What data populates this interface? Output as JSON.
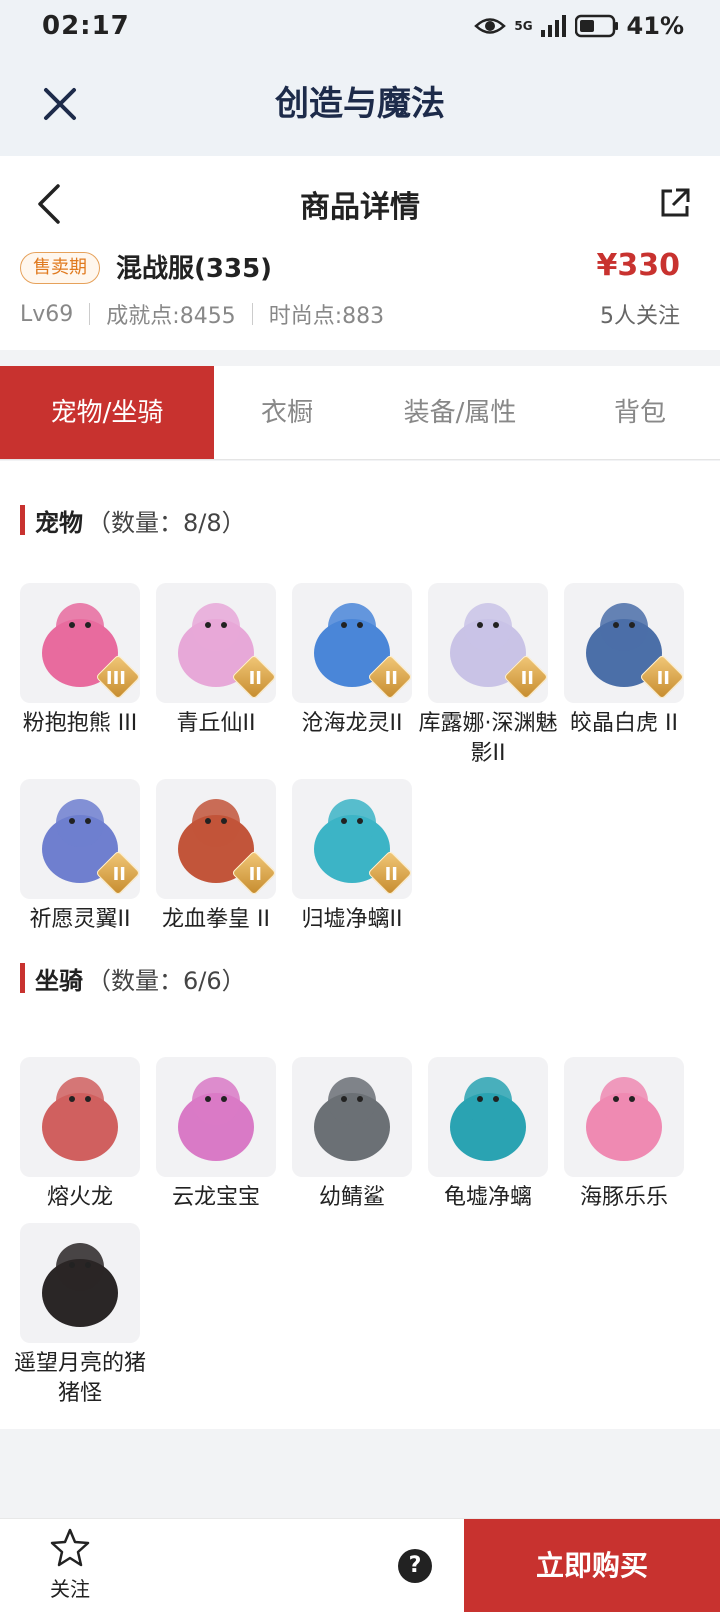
{
  "status": {
    "time": "02:17",
    "network": "5G",
    "battery": "41%"
  },
  "app": {
    "title": "创造与魔法"
  },
  "detail": {
    "nav_title": "商品详情",
    "badge": "售卖期",
    "server_name": "混战服(335)",
    "price": "¥330",
    "stats": {
      "level": "Lv69",
      "achievement": "成就点:8455",
      "fashion": "时尚点:883"
    },
    "followers": "5人关注"
  },
  "tabs": [
    "宠物/坐骑",
    "衣橱",
    "装备/属性",
    "背包"
  ],
  "pets": {
    "title": "宠物",
    "count": "（数量：8/8）",
    "items": [
      {
        "name": "粉抱抱熊 III",
        "tier": "III",
        "color": "#e86b9e"
      },
      {
        "name": "青丘仙II",
        "tier": "II",
        "color": "#e7a8d8"
      },
      {
        "name": "沧海龙灵II",
        "tier": "II",
        "color": "#4a86d8"
      },
      {
        "name": "库露娜·深渊魅影II",
        "tier": "II",
        "color": "#c9c3e6"
      },
      {
        "name": "皎晶白虎 II",
        "tier": "II",
        "color": "#4b6fa8"
      },
      {
        "name": "祈愿灵翼II",
        "tier": "II",
        "color": "#6f7fcf"
      },
      {
        "name": "龙血拳皇 II",
        "tier": "II",
        "color": "#c2553a"
      },
      {
        "name": "归墟净螭II",
        "tier": "II",
        "color": "#3cb4c6"
      }
    ]
  },
  "mounts": {
    "title": "坐骑",
    "count": "（数量：6/6）",
    "items": [
      {
        "name": "熔火龙",
        "color": "#d0605f"
      },
      {
        "name": "云龙宝宝",
        "color": "#d97ac6"
      },
      {
        "name": "幼鲭鲨",
        "color": "#6b7075"
      },
      {
        "name": "龟墟净螭",
        "color": "#2aa3b2"
      },
      {
        "name": "海豚乐乐",
        "color": "#ef8ab2"
      },
      {
        "name": "遥望月亮的猪猪怪",
        "color": "#2a2626"
      }
    ]
  },
  "bottom": {
    "follow_label": "关注",
    "help": "?",
    "buy_label": "立即购买"
  }
}
